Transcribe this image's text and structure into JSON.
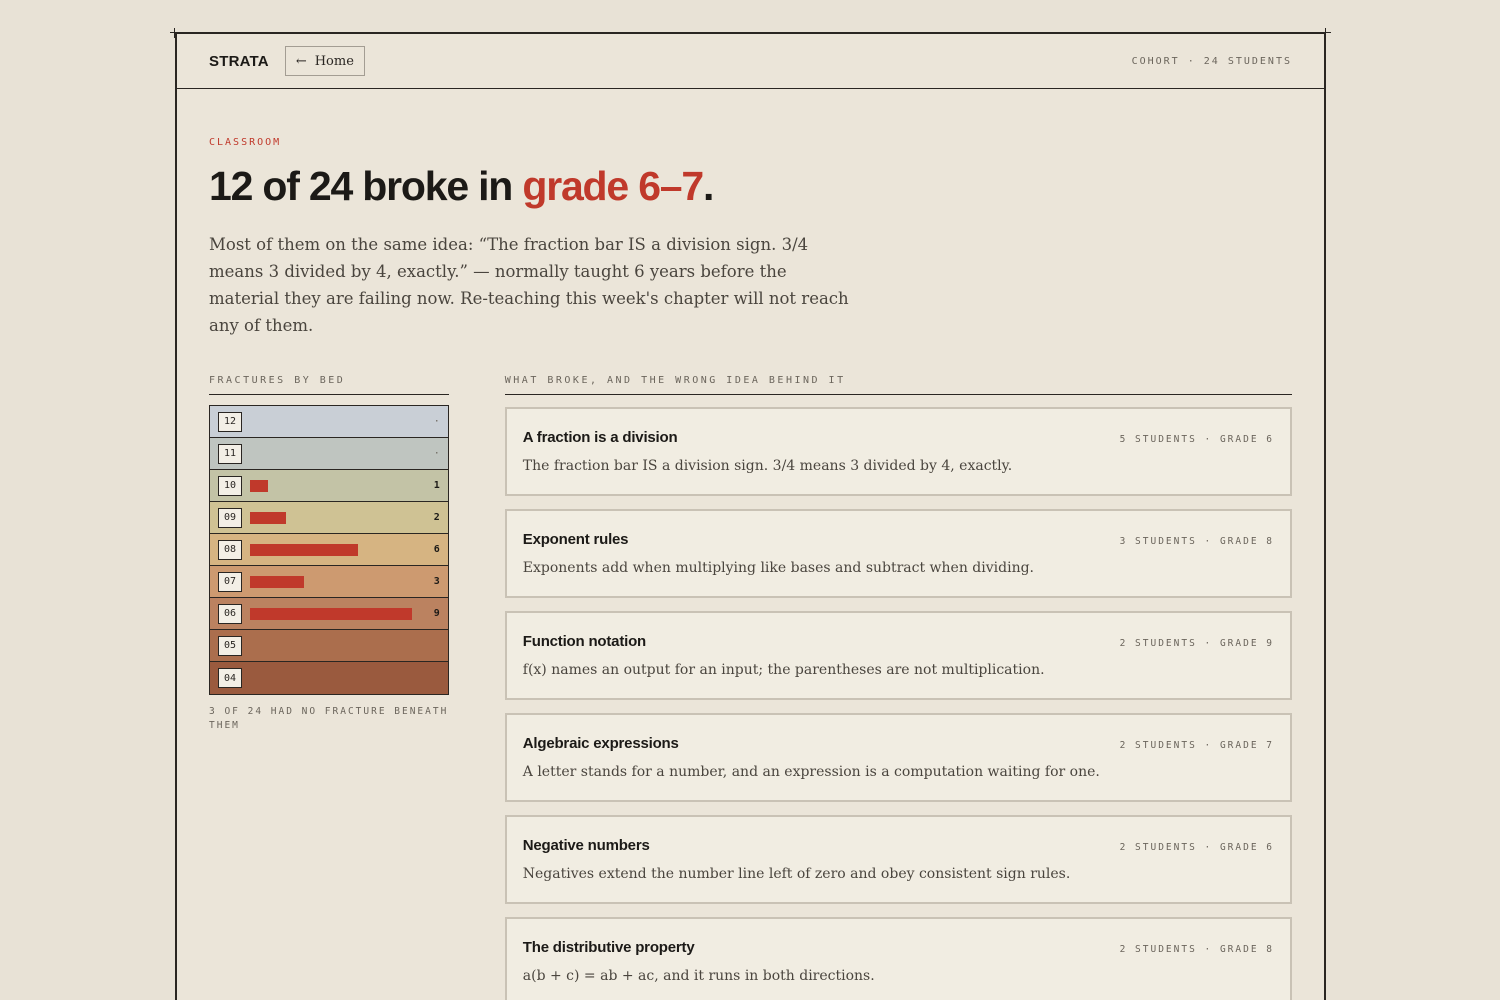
{
  "header": {
    "brand": "STRATA",
    "home_arrow": "←",
    "home_label": "Home",
    "cohort": "COHORT · 24 STUDENTS"
  },
  "hero": {
    "eyebrow": "CLASSROOM",
    "title_main": "12 of 24 broke in ",
    "title_accent": "grade 6–7",
    "title_end": ".",
    "lede": "Most of them on the same idea: “The fraction bar IS a division sign. 3/4 means 3 divided by 4, exactly.” — normally taught 6 years before the material they are failing now. Re-teaching this week's chapter will not reach any of them."
  },
  "fractures": {
    "label": "FRACTURES BY BED",
    "beds": [
      {
        "num": "12",
        "count": "·",
        "value": 0,
        "color": "#c9cfd6"
      },
      {
        "num": "11",
        "count": "·",
        "value": 0,
        "color": "#bfc5c0"
      },
      {
        "num": "10",
        "count": "1",
        "value": 1,
        "color": "#c3c3a6"
      },
      {
        "num": "09",
        "count": "2",
        "value": 2,
        "color": "#cfc294"
      },
      {
        "num": "08",
        "count": "6",
        "value": 6,
        "color": "#d6b482"
      },
      {
        "num": "07",
        "count": "3",
        "value": 3,
        "color": "#cd9a70"
      },
      {
        "num": "06",
        "count": "9",
        "value": 9,
        "color": "#bb8260"
      },
      {
        "num": "05",
        "count": "",
        "value": 0,
        "color": "#ab6e4d"
      },
      {
        "num": "04",
        "count": "",
        "value": 0,
        "color": "#9a5a3e"
      }
    ],
    "max": 9,
    "footnote": "3 OF 24 HAD NO FRACTURE BENEATH THEM"
  },
  "breaks": {
    "label": "WHAT BROKE, AND THE WRONG IDEA BEHIND IT",
    "cards": [
      {
        "title": "A fraction is a division",
        "meta": "5 STUDENTS · GRADE 6",
        "desc": "The fraction bar IS a division sign. 3/4 means 3 divided by 4, exactly."
      },
      {
        "title": "Exponent rules",
        "meta": "3 STUDENTS · GRADE 8",
        "desc": "Exponents add when multiplying like bases and subtract when dividing."
      },
      {
        "title": "Function notation",
        "meta": "2 STUDENTS · GRADE 9",
        "desc": "f(x) names an output for an input; the parentheses are not multiplication."
      },
      {
        "title": "Algebraic expressions",
        "meta": "2 STUDENTS · GRADE 7",
        "desc": "A letter stands for a number, and an expression is a computation waiting for one."
      },
      {
        "title": "Negative numbers",
        "meta": "2 STUDENTS · GRADE 6",
        "desc": "Negatives extend the number line left of zero and obey consistent sign rules."
      },
      {
        "title": "The distributive property",
        "meta": "2 STUDENTS · GRADE 8",
        "desc": "a(b + c) = ab + ac, and it runs in both directions."
      }
    ]
  }
}
